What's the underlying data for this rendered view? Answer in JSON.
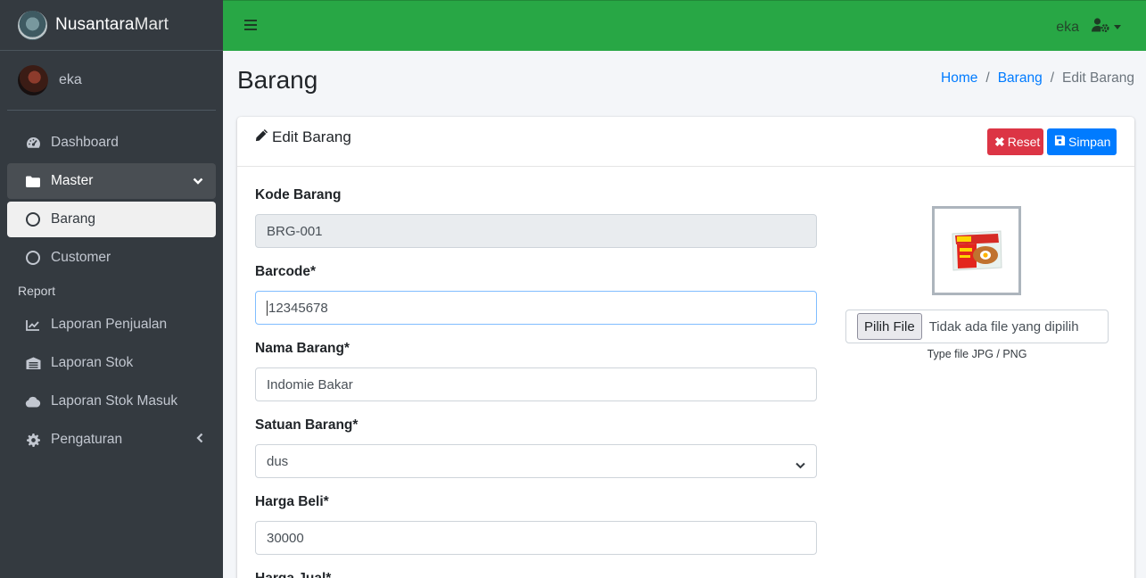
{
  "brand": {
    "name_bold": "Nusantara",
    "name_light": "Mart"
  },
  "user": {
    "name": "eka"
  },
  "sidebar": {
    "items": [
      {
        "label": "Dashboard",
        "icon": "tachometer-icon"
      },
      {
        "label": "Master",
        "icon": "folder-icon"
      },
      {
        "label": "Barang",
        "icon": "circle-icon"
      },
      {
        "label": "Customer",
        "icon": "circle-icon"
      }
    ],
    "report_header": "Report",
    "report_items": [
      {
        "label": "Laporan Penjualan",
        "icon": "chart-line-icon"
      },
      {
        "label": "Laporan Stok",
        "icon": "warehouse-icon"
      },
      {
        "label": "Laporan Stok Masuk",
        "icon": "cloud-icon"
      },
      {
        "label": "Pengaturan",
        "icon": "cog-icon"
      }
    ]
  },
  "topbar": {
    "user_name": "eka"
  },
  "page": {
    "title": "Barang"
  },
  "breadcrumb": {
    "home": "Home",
    "barang": "Barang",
    "current": "Edit Barang"
  },
  "card": {
    "title": "Edit Barang",
    "reset_label": "Reset",
    "save_label": "Simpan"
  },
  "form": {
    "kode_label": "Kode Barang",
    "kode_value": "BRG-001",
    "barcode_label": "Barcode*",
    "barcode_value": "12345678",
    "nama_label": "Nama Barang*",
    "nama_value": "Indomie Bakar",
    "satuan_label": "Satuan Barang*",
    "satuan_value": "dus",
    "harga_beli_label": "Harga Beli*",
    "harga_beli_value": "30000",
    "harga_jual_label": "Harga Jual*"
  },
  "upload": {
    "button_label": "Pilih File",
    "status": "Tidak ada file yang dipilih",
    "hint": "Type file JPG / PNG"
  },
  "colors": {
    "topbar": "#28a745",
    "sidebar": "#343a40",
    "reset": "#dc3545",
    "save": "#007bff",
    "link": "#007bff"
  }
}
